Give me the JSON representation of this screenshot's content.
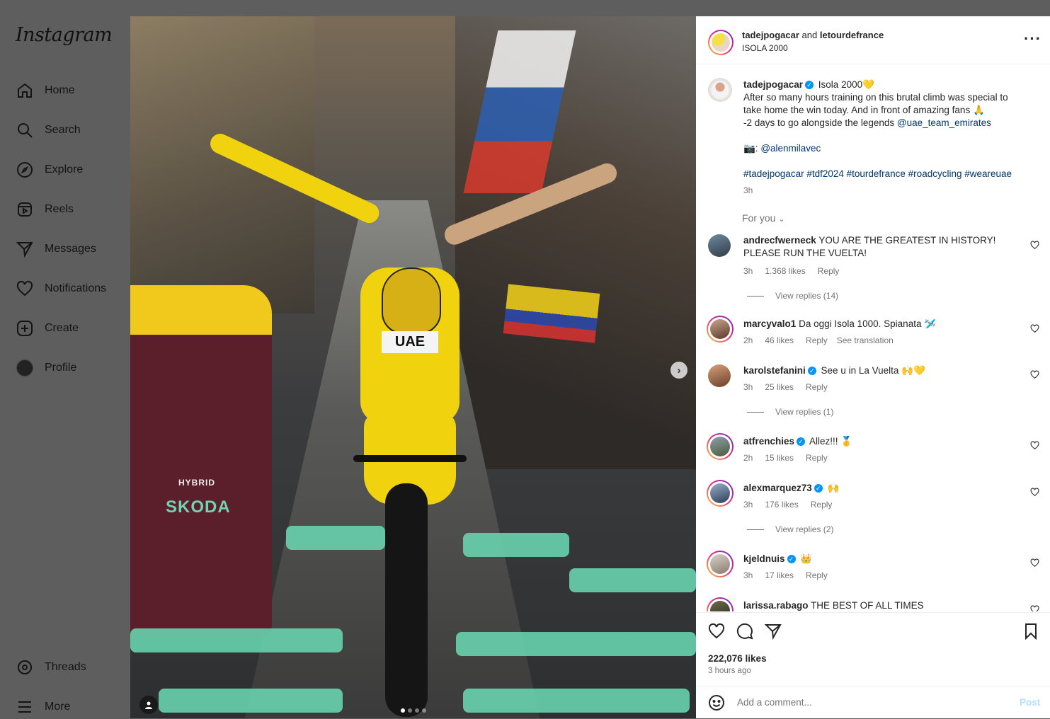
{
  "sidebar": {
    "logo": "Instagram",
    "items": [
      {
        "label": "Home",
        "icon": "home-icon"
      },
      {
        "label": "Search",
        "icon": "search-icon"
      },
      {
        "label": "Explore",
        "icon": "compass-icon"
      },
      {
        "label": "Reels",
        "icon": "reels-icon"
      },
      {
        "label": "Messages",
        "icon": "send-icon"
      },
      {
        "label": "Notifications",
        "icon": "heart-icon"
      },
      {
        "label": "Create",
        "icon": "plus-square-icon"
      },
      {
        "label": "Profile",
        "icon": "avatar-icon"
      }
    ],
    "bottom": [
      {
        "label": "Threads",
        "icon": "threads-icon"
      },
      {
        "label": "More",
        "icon": "menu-icon"
      }
    ]
  },
  "photo": {
    "car_brand": "SKODA",
    "car_hybrid": "HYBRID",
    "jersey_text": "UAE",
    "dots_count": 4,
    "active_dot": 0
  },
  "post": {
    "header": {
      "author1": "tadejpogacar",
      "and": "and",
      "author2": "letourdefrance",
      "location": "ISOLA 2000"
    },
    "caption": {
      "user": "tadejpogacar",
      "title": "Isola 2000💛",
      "line1": "After so many hours training on this brutal climb was special to take home the win today. And in front of amazing fans 🙏",
      "line2_prefix": "-2 days to go alongside the legends ",
      "line2_link": "@uae_team_emirates",
      "photo_prefix": "📷: ",
      "photo_link": "@alenmilavec",
      "hashtags": "#tadejpogacar #tdf2024 #tourdefrance #roadcycling #weareuae",
      "time": "3h"
    },
    "for_you": "For you",
    "comments": [
      {
        "user": "andrecfwerneck",
        "verified": false,
        "text": "YOU ARE THE GREATEST IN HISTORY! PLEASE RUN THE VUELTA!",
        "time": "3h",
        "likes": "1.368 likes",
        "reply": "Reply",
        "view_replies": "View replies (14)"
      },
      {
        "user": "marcyvalo1",
        "verified": false,
        "text": "Da oggi Isola 1000. Spianata 🛩️",
        "time": "2h",
        "likes": "46 likes",
        "reply": "Reply",
        "translate": "See translation"
      },
      {
        "user": "karolstefanini",
        "verified": true,
        "text": "See u in La Vuelta 🙌💛",
        "time": "3h",
        "likes": "25 likes",
        "reply": "Reply",
        "view_replies": "View replies (1)"
      },
      {
        "user": "atfrenchies",
        "verified": true,
        "text": "Allez!!! 🥇",
        "time": "2h",
        "likes": "15 likes",
        "reply": "Reply"
      },
      {
        "user": "alexmarquez73",
        "verified": true,
        "text": "🙌",
        "time": "3h",
        "likes": "176 likes",
        "reply": "Reply",
        "view_replies": "View replies (2)"
      },
      {
        "user": "kjeldnuis",
        "verified": true,
        "text": "👑",
        "time": "3h",
        "likes": "17 likes",
        "reply": "Reply"
      },
      {
        "user": "larissa.rabago",
        "verified": false,
        "text": "THE BEST OF ALL TIMES"
      }
    ],
    "likes": "222,076 likes",
    "ago": "3 hours ago",
    "comment_placeholder": "Add a comment...",
    "post_label": "Post"
  },
  "colors": {
    "verified": "#0095f6",
    "link": "#00376b",
    "post_disabled": "#b2dffc"
  }
}
